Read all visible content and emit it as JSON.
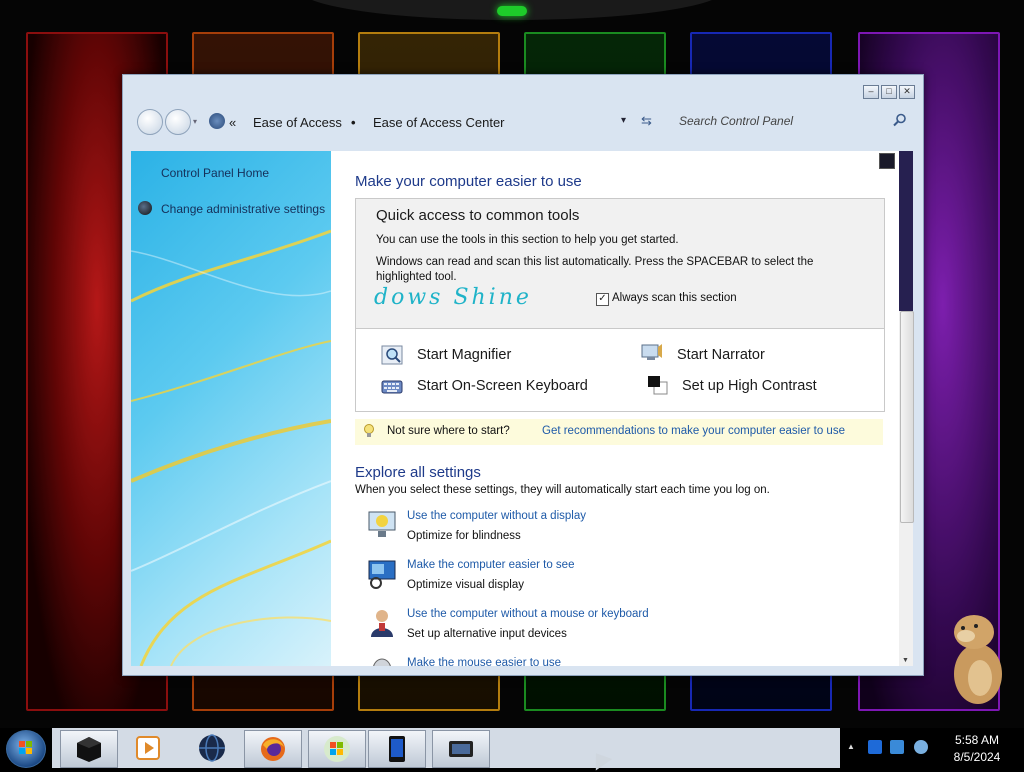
{
  "window": {
    "controls": {
      "minimize": "–",
      "maximize": "□",
      "close": "✕"
    }
  },
  "addressbar": {
    "chevron": "«",
    "breadcrumb": [
      "Ease of Access",
      "Ease of Access Center"
    ],
    "separator": "•",
    "dropdown": "▾",
    "refresh": "⇆",
    "search_placeholder": "Search Control Panel"
  },
  "sidebar": {
    "home": "Control Panel Home",
    "admin": "Change administrative settings"
  },
  "main": {
    "heading": "Make your computer easier to use",
    "quick_access": {
      "title": "Quick access to common tools",
      "desc1": "You can use the tools in this section to help you get started.",
      "desc2": "Windows can read and scan this list automatically.  Press the SPACEBAR to select the highlighted tool.",
      "watermark": "dows Shine",
      "checkbox_checked": true,
      "checkbox_mark": "✓",
      "checkbox_label": "Always scan this section",
      "tools": [
        {
          "label": "Start Magnifier",
          "icon": "magnifier-icon"
        },
        {
          "label": "Start Narrator",
          "icon": "narrator-icon"
        },
        {
          "label": "Start On-Screen Keyboard",
          "icon": "keyboard-icon"
        },
        {
          "label": "Set up High Contrast",
          "icon": "high-contrast-icon"
        }
      ]
    },
    "tip": {
      "text": "Not sure where to start?",
      "link": "Get recommendations to make your computer easier to use"
    },
    "explore": {
      "heading": "Explore all settings",
      "subtitle": "When you select these settings, they will automatically start each time you log on.",
      "items": [
        {
          "link": "Use the computer without a display",
          "desc": "Optimize for blindness",
          "icon": "no-display-icon"
        },
        {
          "link": "Make the computer easier to see",
          "desc": "Optimize visual display",
          "icon": "monitor-icon"
        },
        {
          "link": "Use the computer without a mouse or keyboard",
          "desc": "Set up alternative input devices",
          "icon": "user-icon"
        },
        {
          "link": "Make the mouse easier to use",
          "desc": "",
          "icon": "mouse-icon"
        }
      ]
    }
  },
  "taskbar": {
    "items": [
      "terminal-icon",
      "media-player-icon",
      "globe-icon",
      "firefox-icon",
      "windows-logo-icon",
      "tablet-icon",
      "display-icon"
    ],
    "tray_arrow": "▲",
    "time": "5:58 AM",
    "date": "8/5/2024"
  },
  "colors": {
    "link": "#1e5aa8",
    "heading": "#1e3a8a",
    "tip_bg": "#fdfbdc",
    "window_chrome": "#d9e4f1"
  }
}
